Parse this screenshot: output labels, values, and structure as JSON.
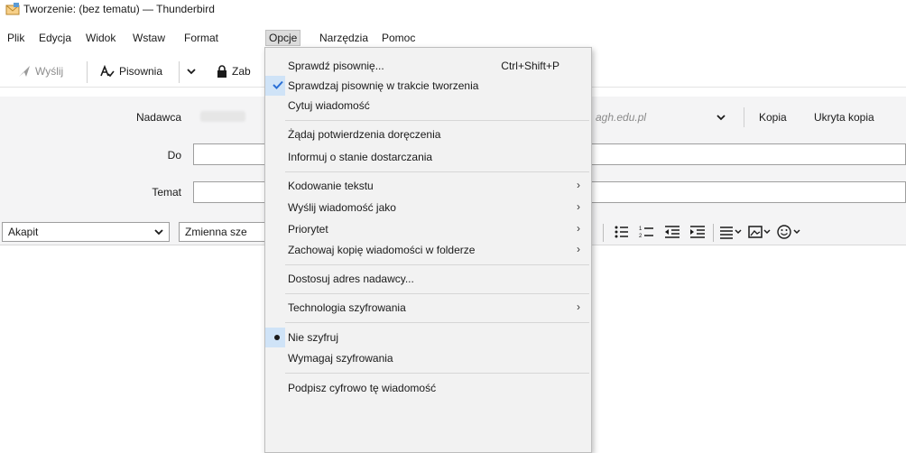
{
  "window": {
    "title": "Tworzenie: (bez tematu) — Thunderbird"
  },
  "menubar": {
    "items": [
      {
        "label": "Plik"
      },
      {
        "label": "Edycja"
      },
      {
        "label": "Widok"
      },
      {
        "label": "Wstaw"
      },
      {
        "label": "Format"
      },
      {
        "label": "Opcje"
      },
      {
        "label": "Narzędzia"
      },
      {
        "label": "Pomoc"
      }
    ]
  },
  "toolbar": {
    "send_label": "Wyślij",
    "spelling_label": "Pisownia",
    "security_label": "Zab"
  },
  "headers": {
    "from_label": "Nadawca",
    "from_domain": "agh.edu.pl",
    "cc_label": "Kopia",
    "bcc_label": "Ukryta kopia",
    "to_label": "Do",
    "subject_label": "Temat"
  },
  "formatbar": {
    "paragraph_value": "Akapit",
    "font_value": "Zmienna sze"
  },
  "options_menu": {
    "items": [
      {
        "label": "Sprawdź pisownię...",
        "shortcut": "Ctrl+Shift+P"
      },
      {
        "label": "Sprawdzaj pisownię w trakcie tworzenia"
      },
      {
        "label": "Cytuj wiadomość"
      },
      {
        "label": "Żądaj potwierdzenia doręczenia"
      },
      {
        "label": "Informuj o stanie dostarczania"
      },
      {
        "label": "Kodowanie tekstu"
      },
      {
        "label": "Wyślij wiadomość jako"
      },
      {
        "label": "Priorytet"
      },
      {
        "label": "Zachowaj kopię wiadomości w folderze"
      },
      {
        "label": "Dostosuj adres nadawcy..."
      },
      {
        "label": "Technologia szyfrowania"
      },
      {
        "label": "Nie szyfruj"
      },
      {
        "label": "Wymagaj szyfrowania"
      },
      {
        "label": "Podpisz cyfrowo tę wiadomość"
      }
    ]
  },
  "colors": {
    "accent": "#3a7bd5",
    "selection": "#cfe3f7",
    "menu_bg": "#f2f2f2",
    "header_bg": "#f4f4f5"
  },
  "icons": [
    "app-icon",
    "send-icon",
    "spelling-icon",
    "lock-icon",
    "chevron-down-icon",
    "checkmark-icon",
    "submenu-arrow-icon",
    "radio-bullet-icon",
    "bullet-list-icon",
    "numbered-list-icon",
    "outdent-icon",
    "indent-icon",
    "align-icon",
    "image-icon",
    "emoji-icon"
  ]
}
